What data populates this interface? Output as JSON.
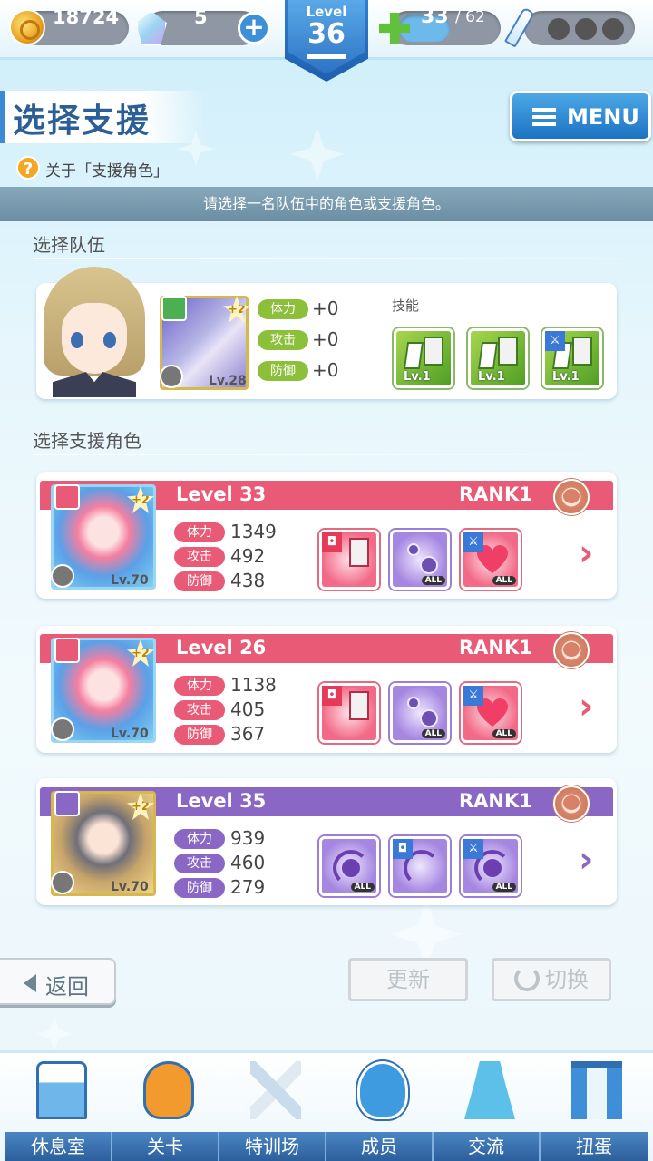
{
  "topbar": {
    "coins": "18724",
    "gems": "5",
    "level_label": "Level",
    "level": "36",
    "stamina_current": "33",
    "stamina_max": "/ 62"
  },
  "header": {
    "title": "选择支援",
    "menu_label": "MENU",
    "help_text": "关于「支援角色」",
    "help_icon": "?",
    "instruction": "请选择一名队伍中的角色或支援角色。"
  },
  "team": {
    "section_label": "选择队伍",
    "card_level": "Lv.28",
    "plus": "+2",
    "stats": [
      {
        "label": "体力",
        "value": "+0"
      },
      {
        "label": "攻击",
        "value": "+0"
      },
      {
        "label": "防御",
        "value": "+0"
      }
    ],
    "skills_label": "技能",
    "skills": [
      {
        "level": "Lv.1",
        "icon": "scroll-icon"
      },
      {
        "level": "Lv.1",
        "icon": "scroll-icon"
      },
      {
        "level": "Lv.1",
        "icon": "sword-scroll-icon"
      }
    ]
  },
  "support": {
    "section_label": "选择支援角色",
    "rows": [
      {
        "level": "Level 33",
        "rank": "RANK1",
        "card_level": "Lv.70",
        "plus": "+2",
        "theme": "red",
        "color": "#e85a76",
        "stats": [
          {
            "label": "体力",
            "value": "1349"
          },
          {
            "label": "攻击",
            "value": "492"
          },
          {
            "label": "防御",
            "value": "438"
          }
        ],
        "skill_tags": [
          "",
          "ALL",
          "ALL"
        ]
      },
      {
        "level": "Level 26",
        "rank": "RANK1",
        "card_level": "Lv.70",
        "plus": "+2",
        "theme": "red",
        "color": "#e85a76",
        "stats": [
          {
            "label": "体力",
            "value": "1138"
          },
          {
            "label": "攻击",
            "value": "405"
          },
          {
            "label": "防御",
            "value": "367"
          }
        ],
        "skill_tags": [
          "",
          "ALL",
          "ALL"
        ]
      },
      {
        "level": "Level 35",
        "rank": "RANK1",
        "card_level": "Lv.70",
        "plus": "+2",
        "theme": "purple",
        "color": "#8a67c4",
        "stats": [
          {
            "label": "体力",
            "value": "939"
          },
          {
            "label": "攻击",
            "value": "460"
          },
          {
            "label": "防御",
            "value": "279"
          }
        ],
        "skill_tags": [
          "ALL",
          "",
          "ALL"
        ]
      }
    ]
  },
  "buttons": {
    "back": "返回",
    "refresh": "更新",
    "switch": "切换"
  },
  "nav": [
    {
      "label": "休息室",
      "icon": "lounge-building-icon"
    },
    {
      "label": "关卡",
      "icon": "stage-monster-icon"
    },
    {
      "label": "特训场",
      "icon": "crossed-swords-icon"
    },
    {
      "label": "成员",
      "icon": "member-cat-icon"
    },
    {
      "label": "交流",
      "icon": "dress-icon"
    },
    {
      "label": "扭蛋",
      "icon": "curtain-stage-icon"
    }
  ]
}
